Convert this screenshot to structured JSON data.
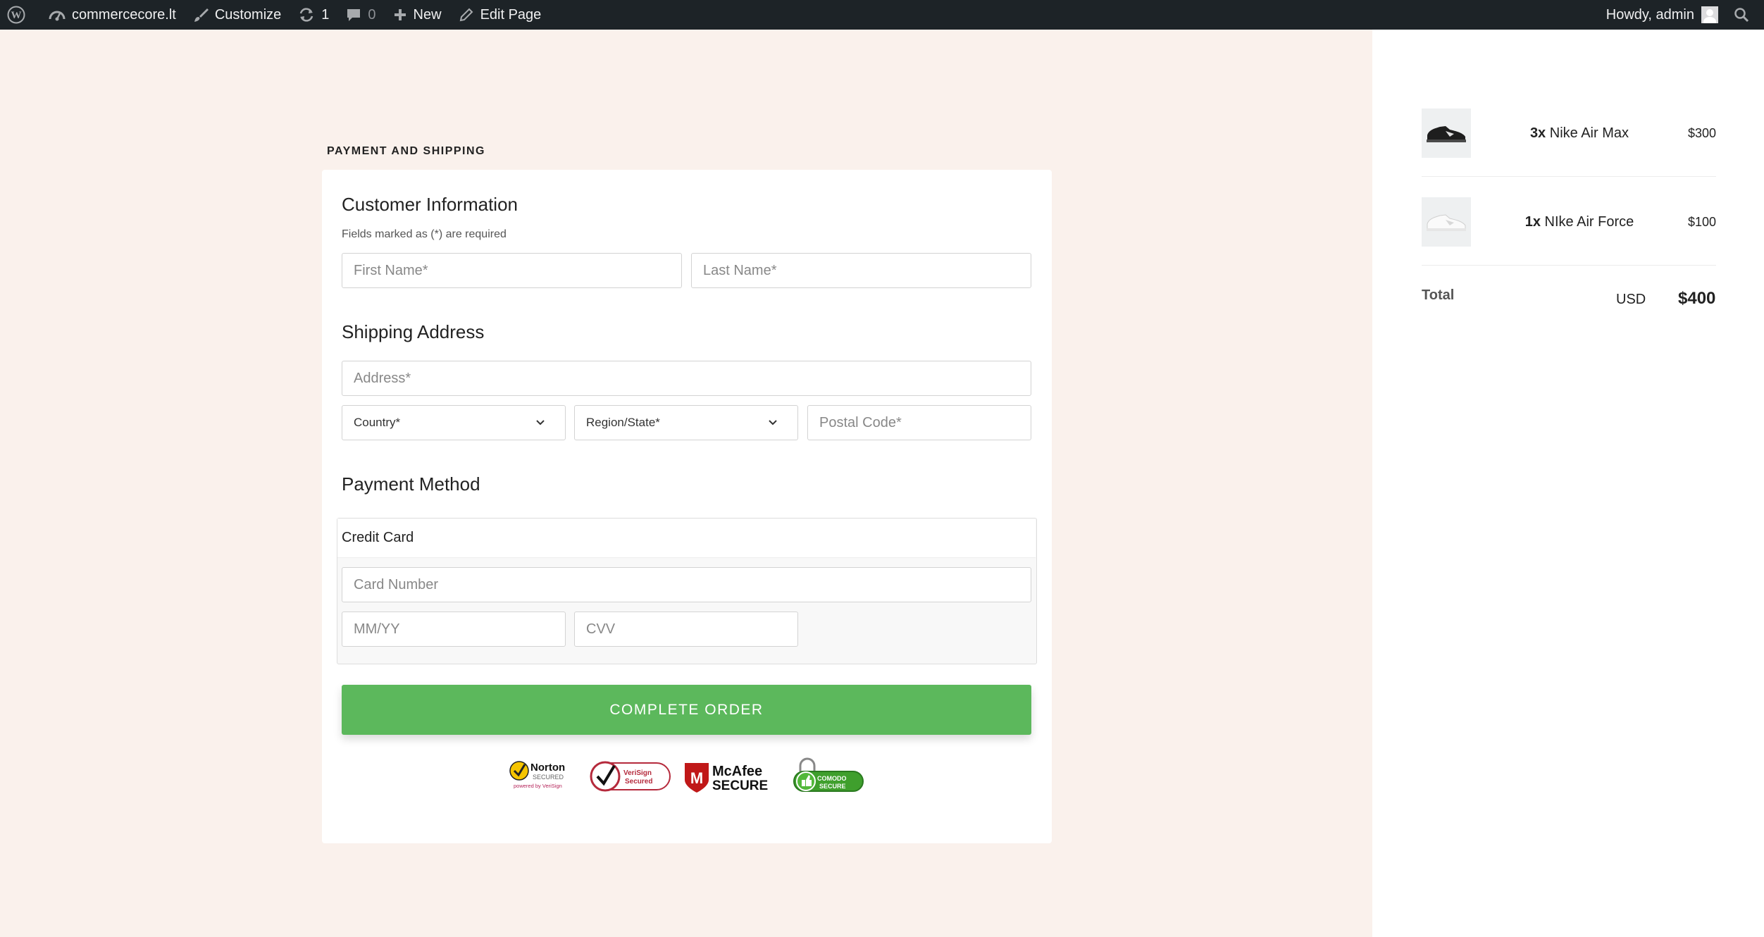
{
  "adminbar": {
    "site_name": "commercecore.lt",
    "customize": "Customize",
    "updates_count": "1",
    "comments_count": "0",
    "new_label": "New",
    "edit_page": "Edit Page",
    "howdy": "Howdy, admin"
  },
  "checkout": {
    "section_title": "PAYMENT AND SHIPPING",
    "customer_heading": "Customer Information",
    "required_note": "Fields marked as (*) are required",
    "first_name_placeholder": "First Name*",
    "last_name_placeholder": "Last Name*",
    "shipping_heading": "Shipping Address",
    "address_placeholder": "Address*",
    "country_label": "Country*",
    "region_label": "Region/State*",
    "postal_placeholder": "Postal Code*",
    "payment_heading": "Payment Method",
    "credit_card_label": "Credit Card",
    "card_number_placeholder": "Card Number",
    "expiry_placeholder": "MM/YY",
    "cvv_placeholder": "CVV",
    "complete_button": "COMPLETE ORDER",
    "accent_color": "#5cb85c"
  },
  "badges": {
    "norton_title": "Norton",
    "norton_sub": "SECURED",
    "norton_powered": "powered by VeriSign",
    "verisign_line1": "VeriSign",
    "verisign_line2": "Secured",
    "mcafee_title": "McAfee",
    "mcafee_sub": "SECURE",
    "comodo_line1": "COMODO",
    "comodo_line2": "SECURE"
  },
  "summary": {
    "items": [
      {
        "qty": "3x",
        "name": "Nike Air Max",
        "price": "$300",
        "thumb": "black-sneaker"
      },
      {
        "qty": "1x",
        "name": "NIke Air Force",
        "price": "$100",
        "thumb": "white-sneaker"
      }
    ],
    "total_label": "Total",
    "currency": "USD",
    "total_value": "$400"
  }
}
